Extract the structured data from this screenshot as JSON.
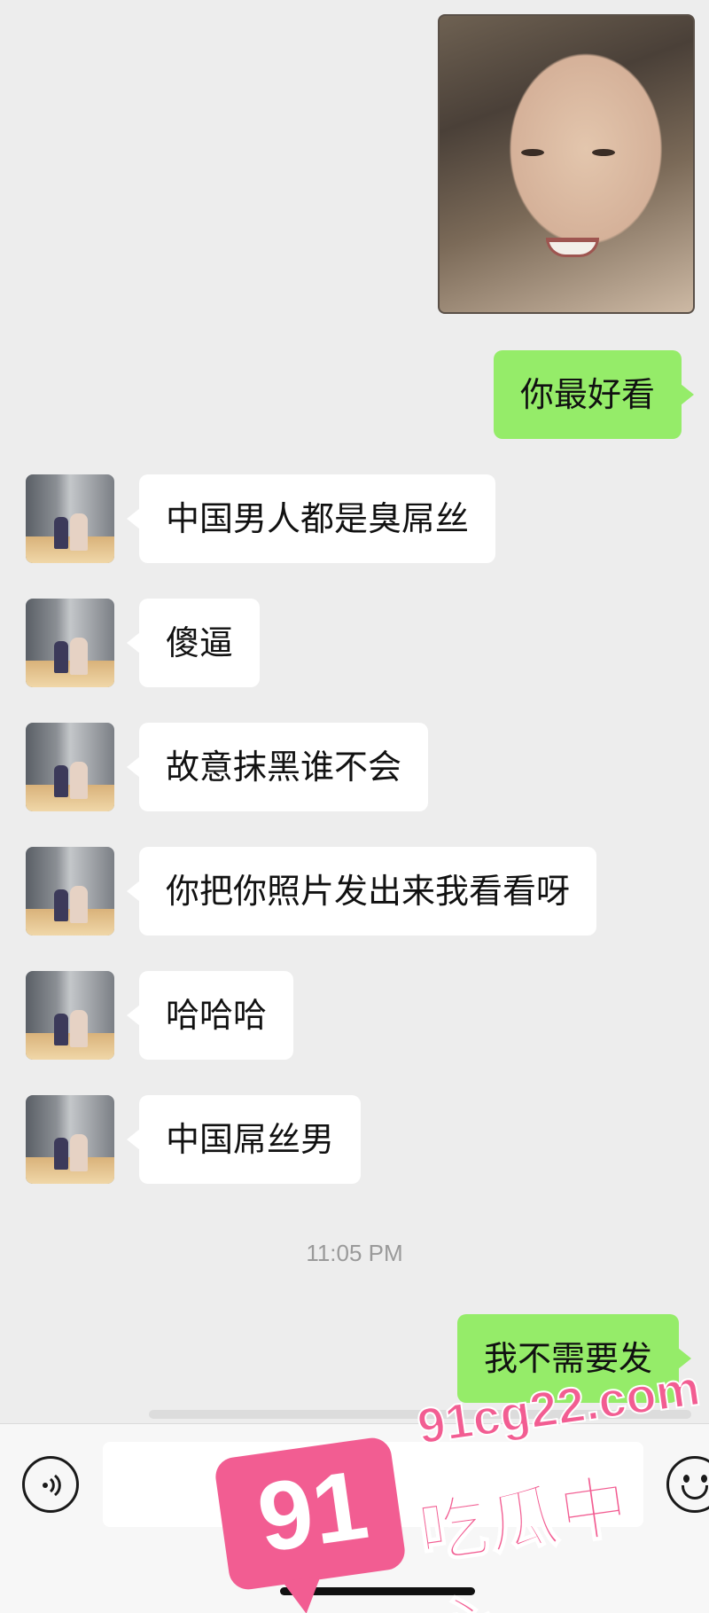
{
  "messages": [
    {
      "side": "out",
      "text": "你最好看"
    },
    {
      "side": "in",
      "text": "中国男人都是臭屌丝"
    },
    {
      "side": "in",
      "text": "傻逼"
    },
    {
      "side": "in",
      "text": "故意抹黑谁不会"
    },
    {
      "side": "in",
      "text": "你把你照片发出来我看看呀"
    },
    {
      "side": "in",
      "text": "哈哈哈"
    },
    {
      "side": "in",
      "text": "中国屌丝男"
    },
    {
      "side": "out",
      "text": "我不需要发"
    }
  ],
  "timestamp": "11:05 PM",
  "input": {
    "value": "",
    "placeholder": ""
  },
  "icons": {
    "voice": "voice-icon",
    "emoji": "emoji-icon"
  },
  "colors": {
    "sent_bubble": "#95ec69",
    "received_bubble": "#ffffff",
    "background": "#ededed",
    "watermark": "#f25d92"
  },
  "watermark": {
    "number": "91",
    "url": "91cg22.com",
    "text": "吃瓜中心"
  }
}
